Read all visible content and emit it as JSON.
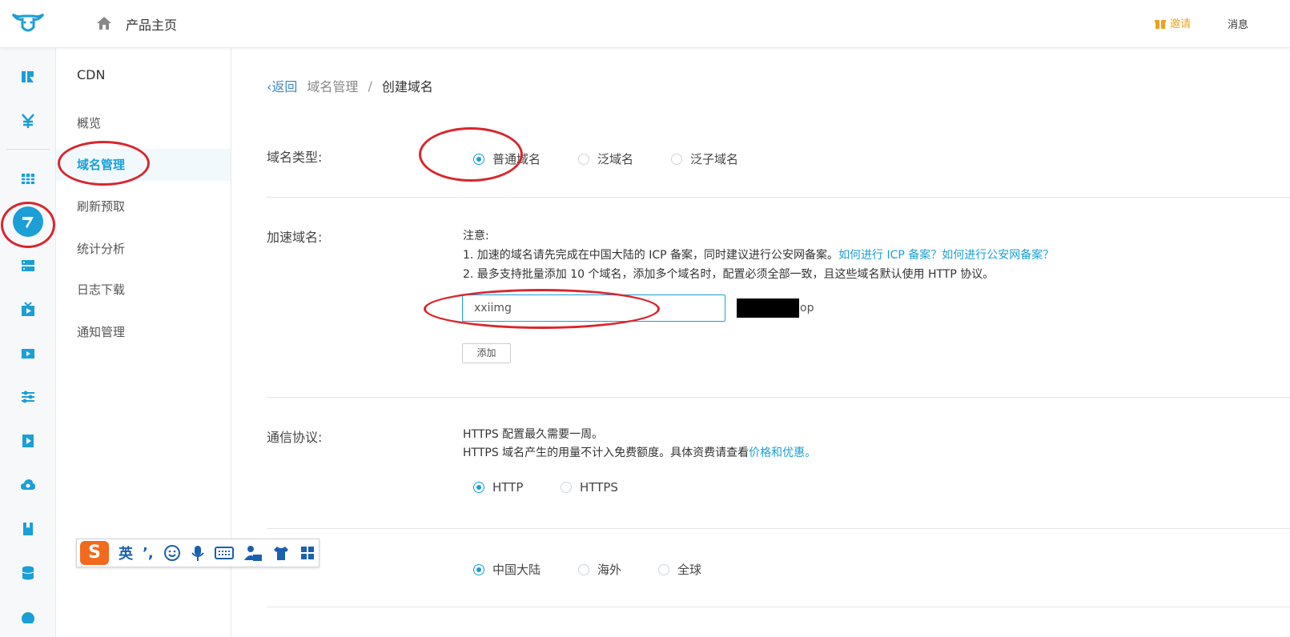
{
  "header": {
    "home_label": "产品主页",
    "invite_label": "邀请",
    "message_label": "消息"
  },
  "icon_sidebar": {
    "items": [
      "ticket-icon",
      "yen-icon",
      "grid-icon",
      "cdn-icon",
      "server-icon",
      "live-icon",
      "video-icon",
      "sliders-icon",
      "player-icon",
      "cloud-icon",
      "bookmark-icon",
      "database-icon"
    ]
  },
  "subnav": {
    "title": "CDN",
    "items": [
      "概览",
      "域名管理",
      "刷新预取",
      "统计分析",
      "日志下载",
      "通知管理"
    ],
    "active_index": 1
  },
  "breadcrumb": {
    "back": "返回",
    "parent": "域名管理",
    "separator": "/",
    "current": "创建域名"
  },
  "domain_type": {
    "label": "域名类型:",
    "options": [
      "普通域名",
      "泛域名",
      "泛子域名"
    ],
    "selected_index": 0
  },
  "accel_domain": {
    "label": "加速域名:",
    "note_title": "注意:",
    "note_1": "1. 加速的域名请先完成在中国大陆的 ICP 备案，同时建议进行公安网备案。",
    "note_1_link": "如何进行 ICP 备案？如何进行公安网备案？",
    "note_2": "2. 最多支持批量添加 10 个域名，添加多个域名时，配置必须全部一致，且这些域名默认使用 HTTP 协议。",
    "input_value": "xxiimg",
    "input_value_tail": "op",
    "add_button": "添加"
  },
  "protocol": {
    "label": "通信协议:",
    "note_1": "HTTPS 配置最久需要一周。",
    "note_2": "HTTPS 域名产生的用量不计入免费额度。具体资费请查看",
    "note_2_link": "价格和优惠。",
    "options": [
      "HTTP",
      "HTTPS"
    ],
    "selected_index": 0
  },
  "region": {
    "options": [
      "中国大陆",
      "海外",
      "全球"
    ],
    "selected_index": 0
  },
  "ime_toolbar": {
    "mode": "英",
    "punct": "’,"
  },
  "colors": {
    "accent": "#1a9fd6",
    "annotation_red": "#d9262e",
    "invite": "#f0a020"
  }
}
